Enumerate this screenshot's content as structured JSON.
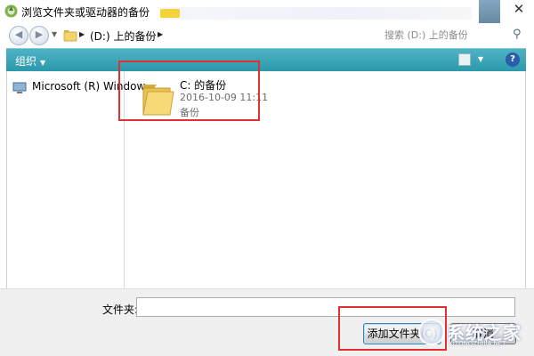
{
  "window": {
    "title": "浏览文件夹或驱动器的备份",
    "close_glyph": "✕"
  },
  "address_bar": {
    "path_label": "(D:) 上的备份",
    "search_placeholder": "搜索 (D:) 上的备份"
  },
  "toolbar": {
    "organize_label": "组织",
    "help_glyph": "?"
  },
  "nav_pane": {
    "items": [
      {
        "label": "Microsoft (R) Window",
        "icon": "computer-icon"
      }
    ]
  },
  "file_list": {
    "items": [
      {
        "name": "C: 的备份",
        "date": "2016-10-09 11:11",
        "type": "备份",
        "icon": "folder-icon"
      }
    ]
  },
  "bottom_bar": {
    "folder_label": "文件夹:",
    "folder_value": "",
    "add_button": "添加文件夹(O)",
    "cancel_button": "取消"
  },
  "watermark": {
    "text": "系统之家",
    "sub": "XITONGZHIJIA.NET"
  },
  "colors": {
    "toolbar": "#2a9aac",
    "highlight": "#e03030"
  }
}
